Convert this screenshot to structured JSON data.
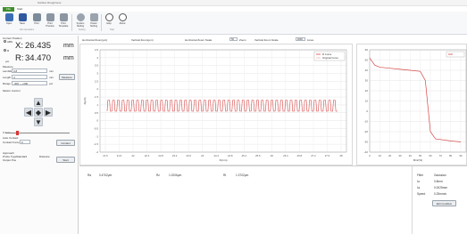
{
  "app": {
    "title": "Surface Roughness",
    "menu_tab": "File",
    "view_tab": "Start"
  },
  "ribbon": {
    "buttons": [
      {
        "label": "Open",
        "icon": "open-icon"
      },
      {
        "label": "Save",
        "icon": "save-icon"
      },
      {
        "label": "Print",
        "icon": "print-icon"
      },
      {
        "label": "Print Preview",
        "icon": "print-preview-icon"
      },
      {
        "label": "Print Template",
        "icon": "template-icon"
      },
      {
        "label": "System Setting",
        "icon": "system-setting-icon"
      },
      {
        "label": "Power Setting",
        "icon": "power-setting-icon"
      },
      {
        "label": "Help",
        "icon": "help-icon"
      },
      {
        "label": "About",
        "icon": "about-icon"
      }
    ],
    "groups": [
      "File Operations",
      "Setting",
      "Help"
    ]
  },
  "left": {
    "current_position_label": "Current Position",
    "abs_label": "ABS",
    "rel_label": "R",
    "x_label": "X:",
    "x_value": "26.435",
    "r_label": "R:",
    "r_value": "34.470",
    "unit": "mm",
    "unit2": "μm",
    "measure_label": "Measure",
    "lambda_label": "Lambda",
    "lambda_value": "0.8",
    "length_label": "Length",
    "length_value": "4",
    "range_label": "Range",
    "range_value": "-400 ~ +400",
    "measure_button": "Measure",
    "motion_control_label": "Motion Control",
    "speed_label": "X Axis",
    "auto_contact_label": "Auto Contact",
    "contact_force_label": "Contact Force",
    "contact_force_value": "0",
    "contact_button": "Contact",
    "approach_label": "Approach",
    "probe_type_label": "Probe Type",
    "probe_type_value": "Standard",
    "distance_label": "Distance",
    "output_pos_label": "Output Pos",
    "start_button": "Start"
  },
  "header": {
    "h_zoom_label": "Horizontal Zoom(μm)",
    "v_zoom_label": "Vertical Zoom(μm)",
    "h_scale_label": "Horizontal Zoom Scale",
    "h_scale_value": "50",
    "h_scale_unit": "Zoom",
    "v_scale_label": "Vertical Zoom Scale",
    "v_scale_value": "2000",
    "v_scale_unit": "Lines"
  },
  "chart_data": [
    {
      "type": "line",
      "title": "",
      "xlabel": "X(mm)",
      "ylabel": "Z(μm)",
      "x_ticks": [
        "21.5",
        "21.6",
        "22",
        "22.4",
        "22.8",
        "23.2",
        "23.6",
        "24",
        "24.4",
        "24.8",
        "25.2",
        "25.6",
        "26",
        "26.4",
        "26.8",
        "27.2",
        "27.6",
        "28"
      ],
      "y_ticks": [
        "4.5",
        "4",
        "3.5",
        "3",
        "2.5",
        "2",
        "1.5",
        "1",
        "0.5",
        "0",
        "-0.5",
        "-1",
        "-1.5",
        "-2"
      ],
      "series": [
        {
          "name": "R Curve",
          "color": "#d64545",
          "cycles": 48,
          "y_min": 0.6,
          "y_max": 1.3
        },
        {
          "name": "Original Curve",
          "color": "#f3b6b6"
        }
      ],
      "legend": "top-right",
      "grid": true
    },
    {
      "type": "line",
      "title": "",
      "xlabel": "Rmr(%)",
      "ylabel": "",
      "x_ticks": [
        "0",
        "10",
        "20",
        "30",
        "40",
        "50",
        "60",
        "70",
        "80",
        "90"
      ],
      "y_ticks": [
        "60",
        "50",
        "40",
        "30",
        "20",
        "10",
        "0",
        "-10",
        "-20",
        "-30",
        "-40"
      ],
      "series": [
        {
          "name": "Bearing Ratio",
          "color": "#d64545",
          "points": [
            [
              0,
              52
            ],
            [
              5,
              45
            ],
            [
              10,
              43
            ],
            [
              20,
              42
            ],
            [
              30,
              41
            ],
            [
              40,
              40
            ],
            [
              50,
              39
            ],
            [
              55,
              30
            ],
            [
              58,
              0
            ],
            [
              60,
              -20
            ],
            [
              65,
              -27
            ],
            [
              80,
              -29
            ],
            [
              90,
              -30
            ]
          ]
        }
      ],
      "legend": "top-right",
      "grid": true
    }
  ],
  "results": {
    "ra_label": "Ra",
    "ra_value": "0.4702μm",
    "rz_label": "Rz",
    "rz_value": "1.0206μm",
    "rt_label": "Rt",
    "rt_value": "1.3702μm",
    "filter_label": "Filter",
    "filter_value": "Gaussian",
    "lc_label": "λc",
    "lc_value": "0.8mm",
    "ls_label": "λs",
    "ls_value": "0.0025mm",
    "speed_label": "Speed",
    "speed_value": "0.25mm/s",
    "edit_button": "Edit Condition"
  },
  "colors": {
    "accent": "#3f8f2c",
    "curve": "#d64545",
    "curve_light": "#f3b6b6"
  }
}
